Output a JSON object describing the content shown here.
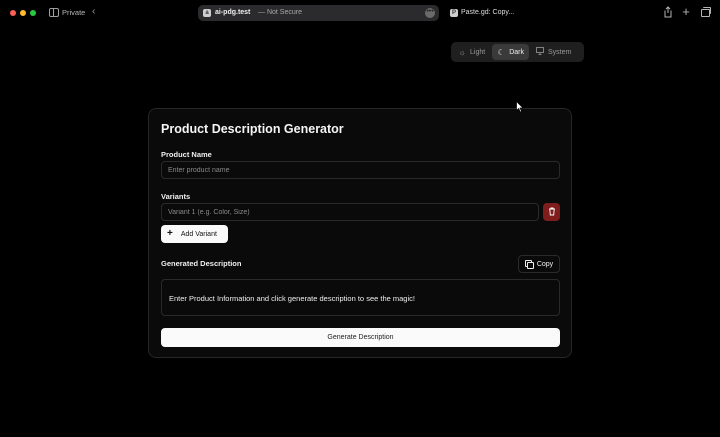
{
  "browser": {
    "private_label": "Private",
    "url_host": "ai-pdg.test",
    "url_suffix": "— Not Secure",
    "second_tab_label": "Paste.gd: Copy..."
  },
  "theme_switcher": {
    "options": [
      "Light",
      "Dark",
      "System"
    ],
    "selected": "Dark"
  },
  "form": {
    "title": "Product Description Generator",
    "product_name_label": "Product Name",
    "product_name_placeholder": "Enter product name",
    "product_name_value": "",
    "variants_label": "Variants",
    "variant_placeholder": "Variant 1 (e.g. Color, Size)",
    "variant_value": "",
    "add_variant_label": "Add Variant",
    "generated_label": "Generated Description",
    "copy_label": "Copy",
    "output_text": "Enter Product Information and click generate description to see the magic!",
    "generate_label": "Generate Description"
  },
  "colors": {
    "background": "#000000",
    "card": "#0a0a0a",
    "delete_button": "#7f1d1d",
    "primary_button": "#fafafa"
  },
  "icons": [
    "sidebar-icon",
    "back-icon",
    "page-icon",
    "more-icon",
    "share-icon",
    "new-tab-icon",
    "tab-overview-icon",
    "sun-icon",
    "moon-icon",
    "monitor-icon",
    "trash-icon",
    "plus-icon",
    "copy-icon",
    "cursor-icon"
  ]
}
